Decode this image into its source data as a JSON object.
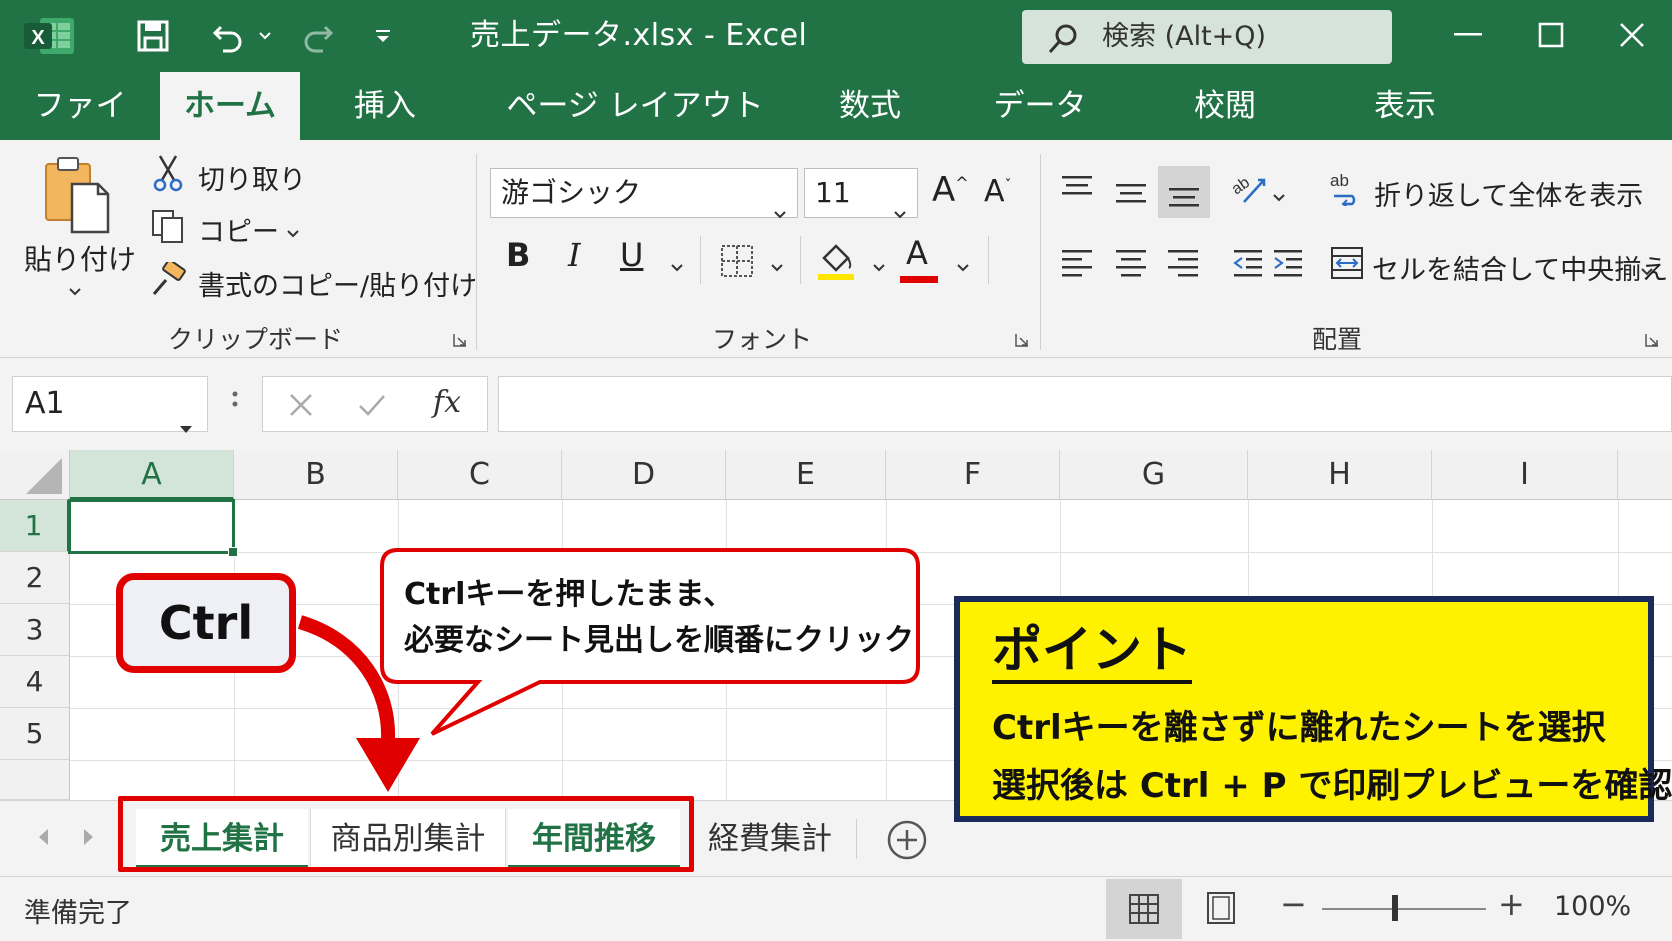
{
  "title_bar": {
    "file_title": "売上データ.xlsx  -  Excel",
    "search_text": "検索 (Alt+Q)"
  },
  "tabs": [
    "ファイル",
    "ホーム",
    "挿入",
    "ページ レイアウト",
    "数式",
    "データ",
    "校閲",
    "表示"
  ],
  "active_tab": "ホーム",
  "ribbon": {
    "clipboard": {
      "paste": "貼り付け",
      "cut": "切り取り",
      "copy": "コピー",
      "format_painter": "書式のコピー/貼り付け",
      "label": "クリップボード"
    },
    "font": {
      "font_name": "游ゴシック",
      "font_size": "11",
      "bold": "B",
      "italic": "I",
      "underline": "U",
      "grow": "A",
      "shrink": "A",
      "font_color": "A",
      "label": "フォント"
    },
    "alignment": {
      "wrap_text": "折り返して全体を表示",
      "merge_center": "セルを結合して中央揃え",
      "label": "配置"
    }
  },
  "formula_bar": {
    "name_box": "A1",
    "fx": "fx",
    "formula": ""
  },
  "grid": {
    "columns": [
      "A",
      "B",
      "C",
      "D",
      "E",
      "F",
      "G",
      "H",
      "I"
    ],
    "rows": [
      "1",
      "2",
      "3",
      "4",
      "5"
    ],
    "selected_column": "A",
    "selected_row": "1"
  },
  "sheets": [
    {
      "name": "売上集計",
      "state": "selected"
    },
    {
      "name": "商品別集計",
      "state": "normal"
    },
    {
      "name": "年間推移",
      "state": "selected"
    },
    {
      "name": "経費集計",
      "state": "plain"
    }
  ],
  "status": {
    "ready": "準備完了",
    "zoom": "100%",
    "zoom_minus": "−",
    "zoom_plus": "+"
  },
  "callouts": {
    "ctrl_key": "Ctrl",
    "bubble_line1": "Ctrlキーを押したまま、",
    "bubble_line2": "必要なシート見出しを順番にクリック",
    "point_title": "ポイント",
    "point_line1": "Ctrlキーを離さずに離れたシートを選択",
    "point_line2": "選択後は Ctrl + P で印刷プレビューを確認"
  },
  "colors": {
    "excel_green": "#217346",
    "callout_red": "#e00000",
    "point_yellow": "#fff200",
    "point_border": "#1a2a5a"
  }
}
